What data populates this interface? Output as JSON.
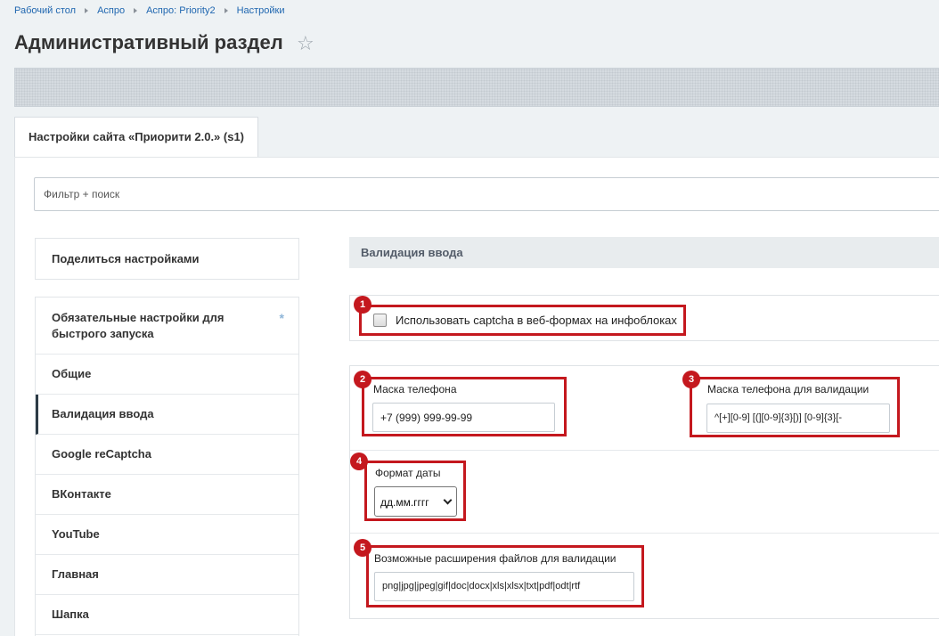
{
  "breadcrumbs": [
    "Рабочий стол",
    "Аспро",
    "Аспро: Priority2",
    "Настройки"
  ],
  "page_title": "Административный раздел",
  "tab": "Настройки сайта «Приорити 2.0.» (s1)",
  "filter_placeholder": "Фильтр + поиск",
  "sidebar": {
    "share": "Поделиться настройками",
    "items": [
      {
        "label": "Обязательные настройки для быстрого запуска",
        "marker": "*"
      },
      {
        "label": "Общие"
      },
      {
        "label": "Валидация ввода",
        "active": true
      },
      {
        "label": "Google reCaptcha"
      },
      {
        "label": "ВКонтакте"
      },
      {
        "label": "YouTube"
      },
      {
        "label": "Главная"
      },
      {
        "label": "Шапка"
      }
    ]
  },
  "section": {
    "title": "Валидация ввода",
    "captcha_label": "Использовать captcha в веб-формах на инфоблоках",
    "captcha_checked": false,
    "phone_mask_label": "Маска телефона",
    "phone_mask_value": "+7 (999) 999-99-99",
    "phone_validation_label": "Маска телефона для валидации",
    "phone_validation_value": "^[+][0-9] [(][0-9]{3}[)] [0-9]{3}[-",
    "date_format_label": "Формат даты",
    "date_format_value": "дд.мм.гггг",
    "file_ext_label": "Возможные расширения файлов для валидации",
    "file_ext_value": "png|jpg|jpeg|gif|doc|docx|xls|xlsx|txt|pdf|odt|rtf"
  },
  "annotations": [
    "1",
    "2",
    "3",
    "4",
    "5"
  ],
  "colors": {
    "annotation": "#c4181e",
    "link": "#2067b0",
    "active_marker": "#2d3b46"
  }
}
